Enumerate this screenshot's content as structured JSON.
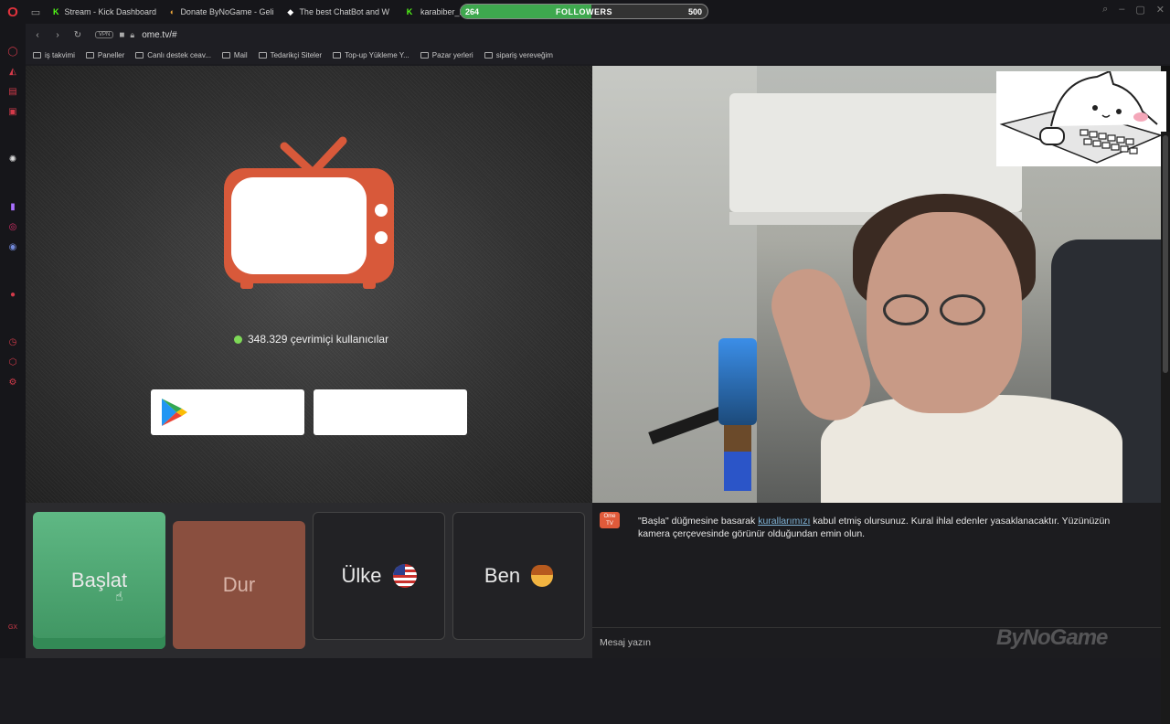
{
  "browser": {
    "tabs": [
      {
        "label": "Stream - Kick Dashboard",
        "fav": "K",
        "color": "#53fc18"
      },
      {
        "label": "Donate ByNoGame - Geli",
        "fav": "◐",
        "color": "#f2a93b"
      },
      {
        "label": "The best ChatBot and W",
        "fav": "◆",
        "color": "#ffffff"
      },
      {
        "label": "karabiber_2",
        "fav": "K",
        "color": "#53fc18"
      }
    ],
    "url": "ome.tv/#",
    "vpn_label": "VPN",
    "bookmarks": [
      "iş takvimi",
      "Paneller",
      "Canlı destek ceav...",
      "Mail",
      "Tedarikçi Siteler",
      "Top-up Yükleme Y...",
      "Pazar yerleri",
      "sipariş vereveğim"
    ]
  },
  "followers_widget": {
    "current": "264",
    "label": "FOLLOWERS",
    "goal": "500",
    "progress": 0.528
  },
  "ome": {
    "online_text": "348.329 çevrimiçi kullanıcılar",
    "buttons": {
      "start": "Başlat",
      "stop": "Dur",
      "country": "Ülke",
      "me": "Ben"
    },
    "chat_logo": "Ome TV",
    "chat_message_prefix": "\"Başla\" düğmesine basarak ",
    "chat_message_link": "kurallarımızı",
    "chat_message_suffix": " kabul etmiş olursunuz. Kural ihlal edenler yasaklanacaktır. Yüzünüzün kamera çerçevesinde görünür olduğundan emin olun.",
    "chat_placeholder": "Mesaj yazın"
  },
  "watermark": "ByNoGame",
  "colors": {
    "start": "#4aa46e",
    "stop": "#8a4f3f",
    "tv_logo": "#d8593a",
    "online_dot": "#7ed957",
    "accent_opera": "#e0323c"
  }
}
